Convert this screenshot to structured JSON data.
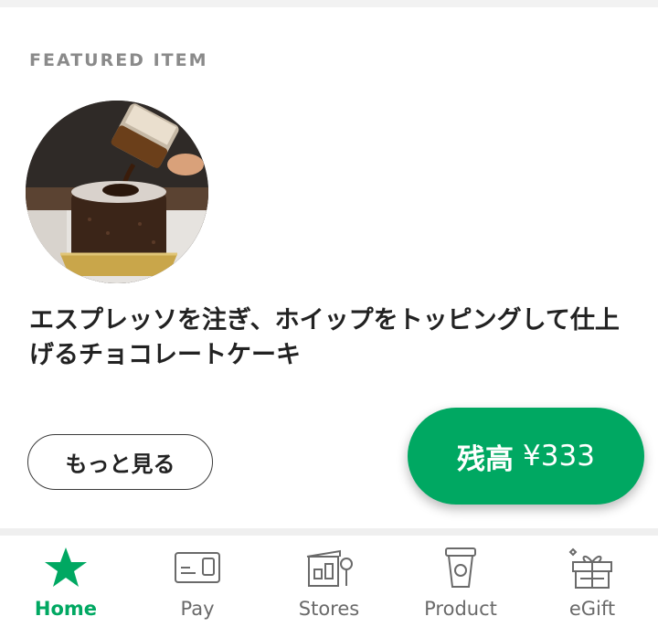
{
  "featured": {
    "section_label": "FEATURED ITEM",
    "description": "エスプレッソを注ぎ、ホイップをトッピングして仕上げるチョコレートケーキ",
    "image_icon": "chocolate-cake-espresso-photo",
    "more_button_label": "もっと見る"
  },
  "balance": {
    "label": "残高",
    "amount": "¥333"
  },
  "colors": {
    "accent": "#00a862",
    "inactive": "#6a6a6a"
  },
  "tabbar": {
    "items": [
      {
        "label": "Home",
        "icon": "star-icon",
        "active": true
      },
      {
        "label": "Pay",
        "icon": "pay-card-icon",
        "active": false
      },
      {
        "label": "Stores",
        "icon": "store-icon",
        "active": false
      },
      {
        "label": "Product",
        "icon": "cup-icon",
        "active": false
      },
      {
        "label": "eGift",
        "icon": "gift-icon",
        "active": false
      }
    ]
  }
}
